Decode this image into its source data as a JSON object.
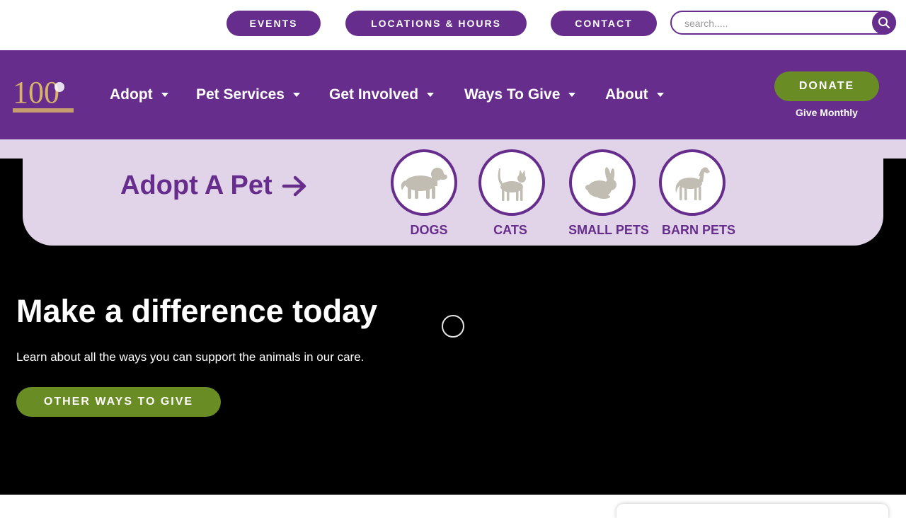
{
  "topbar": {
    "events_label": "EVENTS",
    "locations_label": "LOCATIONS & HOURS",
    "contact_label": "CONTACT",
    "search_placeholder": "search....."
  },
  "nav": {
    "logo_text": "100",
    "items": [
      {
        "label": "Adopt"
      },
      {
        "label": "Pet Services"
      },
      {
        "label": "Get Involved"
      },
      {
        "label": "Ways To Give"
      },
      {
        "label": "About"
      }
    ],
    "donate_label": "DONATE",
    "give_monthly_label": "Give Monthly"
  },
  "adopt": {
    "link_label": "Adopt A Pet",
    "pets": [
      {
        "label": "DOGS",
        "icon": "dog-icon"
      },
      {
        "label": "CATS",
        "icon": "cat-icon"
      },
      {
        "label": "SMALL PETS",
        "icon": "rabbit-icon"
      },
      {
        "label": "BARN PETS",
        "icon": "horse-icon"
      }
    ]
  },
  "hero": {
    "title": "Make a difference today",
    "subtitle": "Learn about all the ways you can support the animals in our care.",
    "cta_label": "OTHER WAYS TO GIVE"
  },
  "colors": {
    "brand_purple": "#662d8c",
    "lavender": "#e2d4e8",
    "green": "#6a8c25",
    "pet_silhouette": "#c2bdb2"
  }
}
